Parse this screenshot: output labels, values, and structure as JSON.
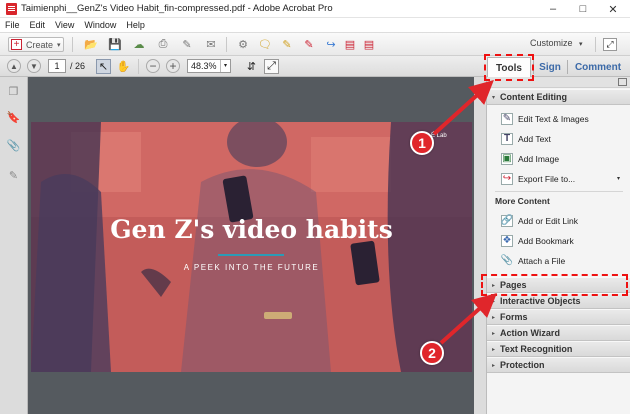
{
  "window": {
    "title": "Taimienphi__GenZ's Video Habit_fin-compressed.pdf - Adobe Acrobat Pro",
    "min": "–",
    "max": "□",
    "close": "✕"
  },
  "menu": [
    "File",
    "Edit",
    "View",
    "Window",
    "Help"
  ],
  "toolbar": {
    "create_label": "Create",
    "create_caret": "▾",
    "customize_label": "Customize",
    "customize_caret": "▾"
  },
  "nav": {
    "current_page": "1",
    "page_total": "/ 26",
    "zoom": "48.3%",
    "zoom_caret": "▾"
  },
  "tabs": {
    "tools": "Tools",
    "sign": "Sign",
    "comment": "Comment"
  },
  "document": {
    "title": "Gen Z's video habits",
    "subtitle": "A PEEK INTO THE FUTURE",
    "corner_tag": "É Lab"
  },
  "pane": {
    "content_editing": "Content Editing",
    "items": [
      "Edit Text & Images",
      "Add Text",
      "Add Image",
      "Export File to..."
    ],
    "export_caret": "▾",
    "more_content": "More Content",
    "more_items": [
      "Add or Edit Link",
      "Add Bookmark",
      "Attach a File"
    ],
    "sections": [
      "Pages",
      "Interactive Objects",
      "Forms",
      "Action Wizard",
      "Text Recognition",
      "Protection"
    ],
    "collapsed_arrow": "▸",
    "expanded_arrow": "▾"
  },
  "annotations": {
    "step1": "1",
    "step2": "2"
  },
  "colors": {
    "annotation_red": "#e0262b",
    "tab_blue": "#3c6aa8",
    "photo_overlay": "#c35c5a",
    "title_underline": "#2a9bb6"
  }
}
